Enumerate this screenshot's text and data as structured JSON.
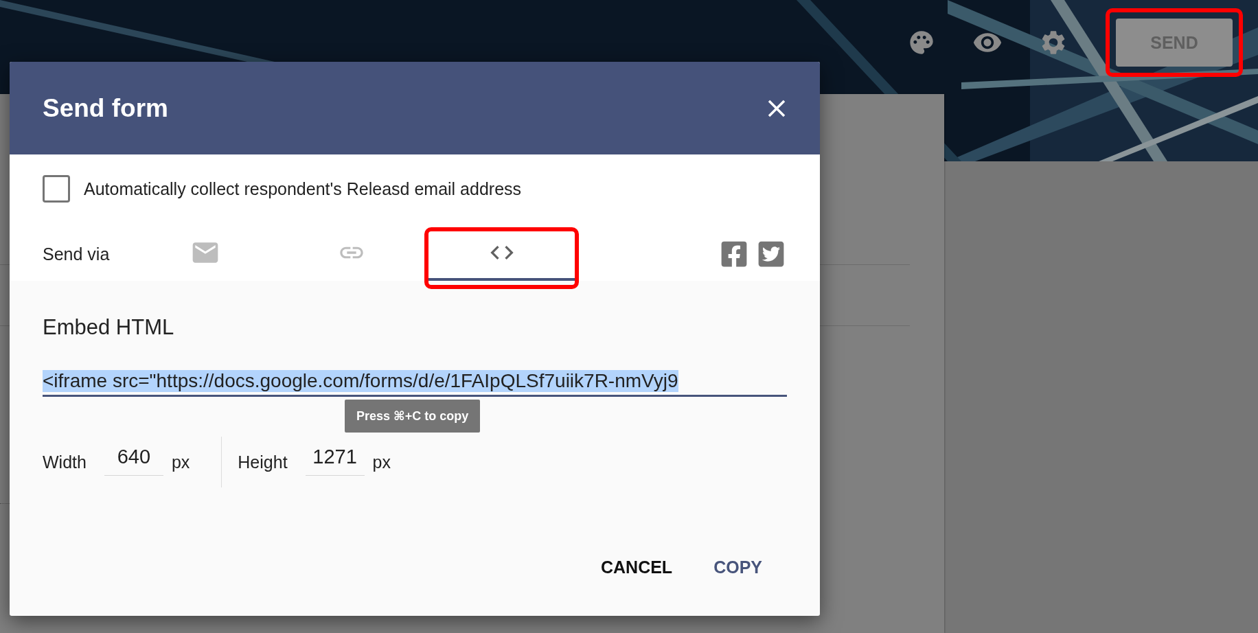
{
  "toolbar": {
    "send_button": "SEND"
  },
  "dialog": {
    "title": "Send form",
    "collect_email": {
      "label": "Automatically collect respondent's Releasd email address",
      "checked": false
    },
    "send_via": {
      "label": "Send via",
      "tabs": [
        {
          "kind": "email",
          "selected": false
        },
        {
          "kind": "link",
          "selected": false
        },
        {
          "kind": "embed",
          "selected": true
        }
      ],
      "social": [
        {
          "kind": "facebook"
        },
        {
          "kind": "twitter"
        }
      ]
    },
    "embed": {
      "heading": "Embed HTML",
      "code": "<iframe src=\"https://docs.google.com/forms/d/e/1FAIpQLSf7uiik7R-nmVyj9",
      "code_selected": true,
      "tooltip": "Press ⌘+C to copy",
      "width": {
        "label": "Width",
        "value": "640",
        "unit": "px"
      },
      "height": {
        "label": "Height",
        "value": "1271",
        "unit": "px"
      }
    },
    "actions": [
      {
        "label": "CANCEL",
        "primary": false
      },
      {
        "label": "COPY",
        "primary": true
      }
    ]
  }
}
